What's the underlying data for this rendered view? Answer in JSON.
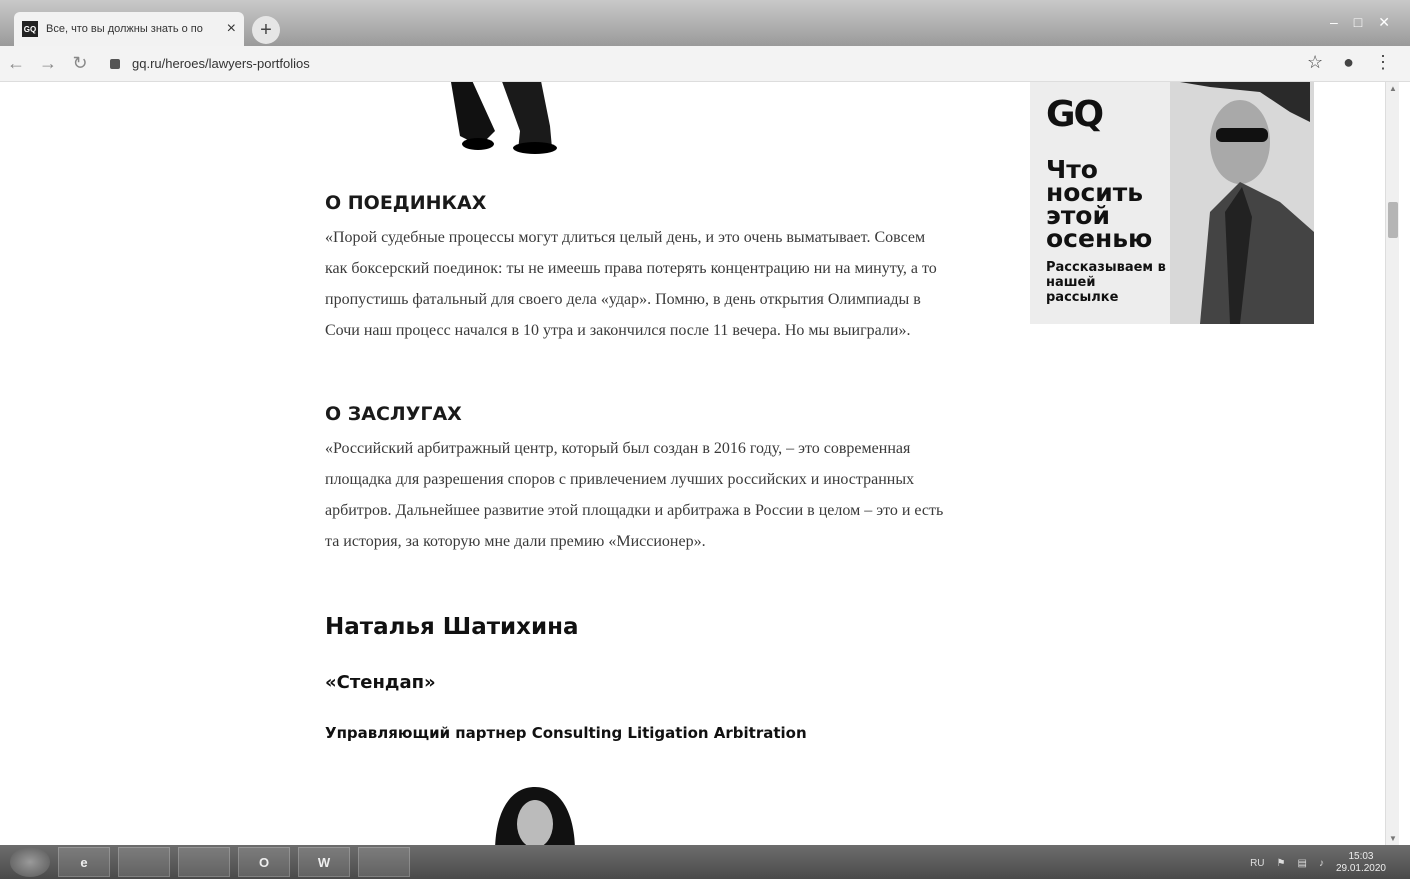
{
  "browser": {
    "tab_favicon": "GQ",
    "tab_title": "Все, что вы должны знать о по",
    "tab_close": "×",
    "new_tab": "+",
    "url": "gq.ru/heroes/lawyers-portfolios"
  },
  "article": {
    "section1_title": "О ПОЕДИНКАХ",
    "section1_text": "«Порой судебные процессы могут длиться целый день, и это очень выматывает. Совсем как боксерский поединок: ты не имеешь права потерять концентрацию ни на минуту, а то пропустишь фатальный для своего дела «удар». Помню, в день открытия Олимпиады в Сочи наш процесс начался в 10 утра и закончился после 11 вечера. Но мы выиграли».",
    "section2_title": "О ЗАСЛУГАХ",
    "section2_text": "«Российский арбитражный центр, который был создан в 2016 году, – это современная площадка для разрешения споров с привлечением лучших российских и иностранных арбитров. Дальнейшее развитие этой площадки и арбитража в России в целом – это и есть та история, за которую мне дали премию «Миссионер».",
    "person_name": "Наталья Шатихина",
    "company": "«Стендап»",
    "position": "Управляющий партнер Consulting Litigation Arbitration"
  },
  "ad": {
    "logo": "GQ",
    "headline": "Что носить этой осенью",
    "subtext": "Рассказываем в нашей рассылке"
  },
  "taskbar": {
    "apps": [
      "e",
      "",
      "",
      "O",
      "W",
      ""
    ],
    "lang": "RU",
    "time": "15:03",
    "date": "29.01.2020"
  }
}
